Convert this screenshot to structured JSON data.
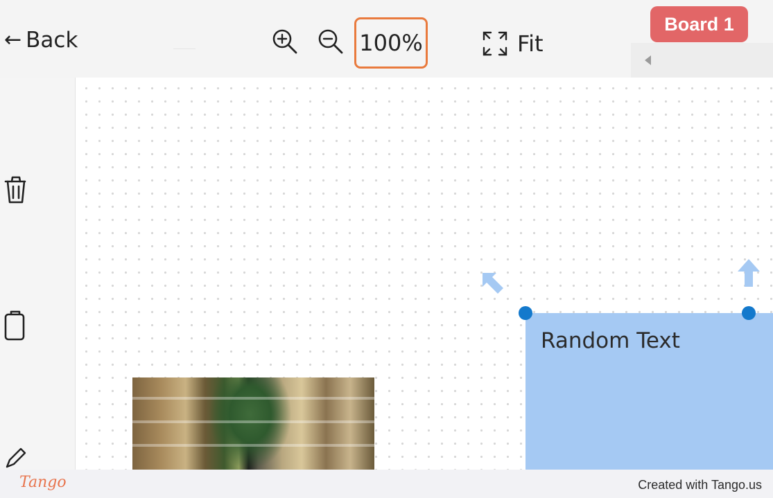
{
  "toolbar": {
    "back_label": "Back",
    "zoom_level": "100%",
    "fit_label": "Fit",
    "board_name": "Board 1",
    "icons": [
      "back-arrow-icon",
      "zoom-in-icon",
      "zoom-out-icon",
      "fit-screen-icon"
    ]
  },
  "sidebar": {
    "icons": [
      "trash-icon",
      "clipboard-icon",
      "pen-icon"
    ]
  },
  "canvas": {
    "note_text": "Random Text",
    "note_color": "#a5c9f3",
    "handle_color": "#1479cc"
  },
  "footer": {
    "logo": "Tango",
    "credit": "Created with Tango.us"
  },
  "colors": {
    "highlight": "#e97a3d",
    "board_badge": "#e26667"
  }
}
